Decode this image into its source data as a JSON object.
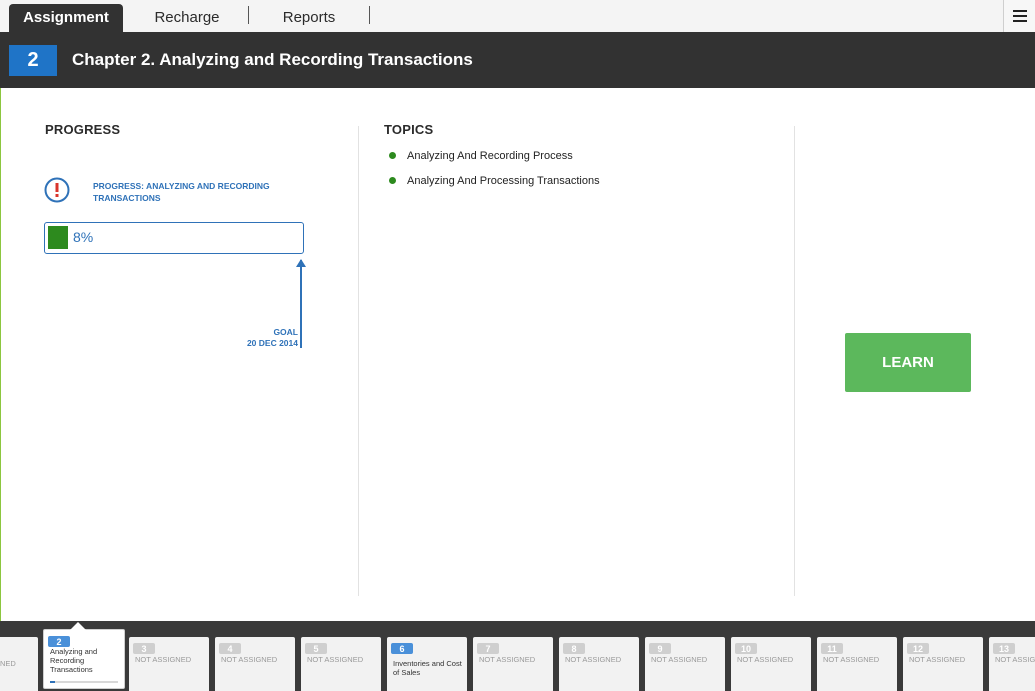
{
  "tabs": [
    {
      "label": "Assignment",
      "active": true
    },
    {
      "label": "Recharge",
      "active": false
    },
    {
      "label": "Reports",
      "active": false
    }
  ],
  "menu_icon": "hamburger-icon",
  "chapter": {
    "number": "2",
    "title": "Chapter 2. Analyzing and Recording Transactions"
  },
  "progress": {
    "heading": "PROGRESS",
    "label": "PROGRESS: ANALYZING AND RECORDING TRANSACTIONS",
    "percent_text": "8%",
    "percent_value": 8,
    "goal_label": "GOAL",
    "goal_date": "20 DEC 2014",
    "icon": "exclamation-circle-icon"
  },
  "topics": {
    "heading": "TOPICS",
    "items": [
      "Analyzing And Recording Process",
      "Analyzing And Processing Transactions"
    ]
  },
  "learn_button": "LEARN",
  "chapters_strip": {
    "partial_left_text": "NED",
    "cards": [
      {
        "num": "2",
        "text": "Analyzing and Recording Transactions",
        "selected": true,
        "assigned": true
      },
      {
        "num": "3",
        "text": "NOT ASSIGNED",
        "selected": false,
        "assigned": false
      },
      {
        "num": "4",
        "text": "NOT ASSIGNED",
        "selected": false,
        "assigned": false
      },
      {
        "num": "5",
        "text": "NOT ASSIGNED",
        "selected": false,
        "assigned": false
      },
      {
        "num": "6",
        "text": "Inventories and Cost of Sales",
        "selected": false,
        "assigned": true
      },
      {
        "num": "7",
        "text": "NOT ASSIGNED",
        "selected": false,
        "assigned": false
      },
      {
        "num": "8",
        "text": "NOT ASSIGNED",
        "selected": false,
        "assigned": false
      },
      {
        "num": "9",
        "text": "NOT ASSIGNED",
        "selected": false,
        "assigned": false
      },
      {
        "num": "10",
        "text": "NOT ASSIGNED",
        "selected": false,
        "assigned": false
      },
      {
        "num": "11",
        "text": "NOT ASSIGNED",
        "selected": false,
        "assigned": false
      },
      {
        "num": "12",
        "text": "NOT ASSIGNED",
        "selected": false,
        "assigned": false
      },
      {
        "num": "13",
        "text": "NOT ASSIGNED",
        "selected": false,
        "assigned": false
      }
    ]
  },
  "colors": {
    "accent_blue": "#2f72b8",
    "chapter_blue": "#1f74c7",
    "progress_green": "#2d8a1e",
    "learn_green": "#5cb85c",
    "header_dark": "#323232"
  }
}
